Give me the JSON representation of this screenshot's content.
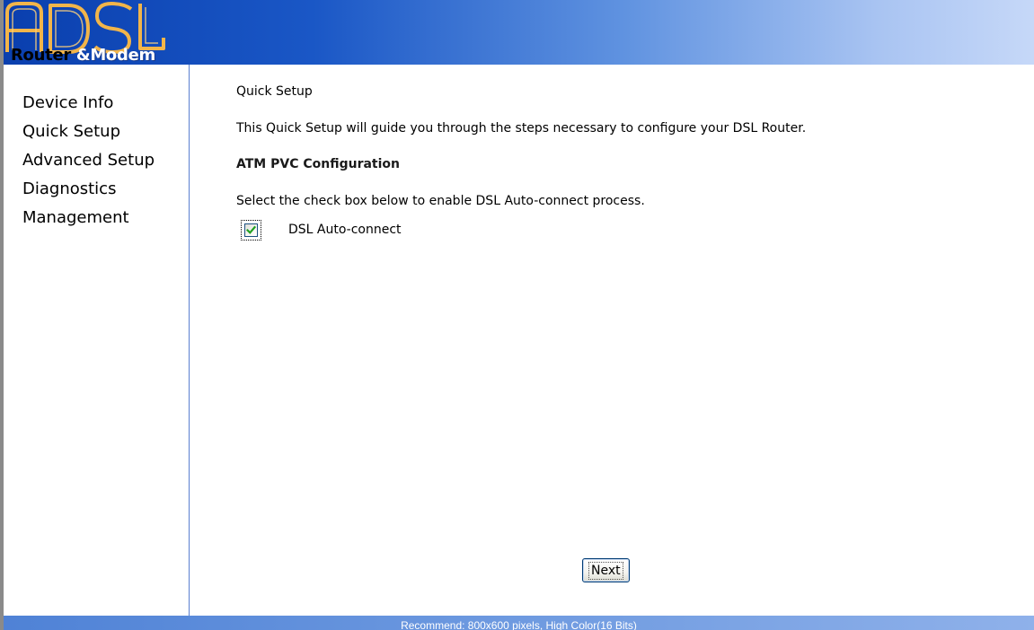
{
  "header": {
    "logo_word_1": "Router",
    "logo_word_2": "&",
    "logo_word_3": "Modem",
    "logo_letters": "ADSL"
  },
  "sidebar": {
    "items": [
      {
        "label": "Device Info"
      },
      {
        "label": "Quick Setup"
      },
      {
        "label": "Advanced Setup"
      },
      {
        "label": "Diagnostics"
      },
      {
        "label": "Management"
      }
    ]
  },
  "main": {
    "title": "Quick Setup",
    "intro": "This Quick Setup will guide you through the steps necessary to configure your DSL Router.",
    "section_title": "ATM PVC Configuration",
    "instruction": "Select the check box below to enable DSL Auto-connect process.",
    "auto_connect": {
      "label": "DSL Auto-connect",
      "checked": true
    },
    "next_label": "Next"
  },
  "footer": {
    "text": "Recommend: 800x600 pixels, High Color(16 Bits)"
  },
  "colors": {
    "header_start": "#0a3fae",
    "header_end": "#c6d8f8",
    "footer": "#6e9ae0",
    "logo_outline": "#f2b54a",
    "checkmark": "#21a121"
  }
}
